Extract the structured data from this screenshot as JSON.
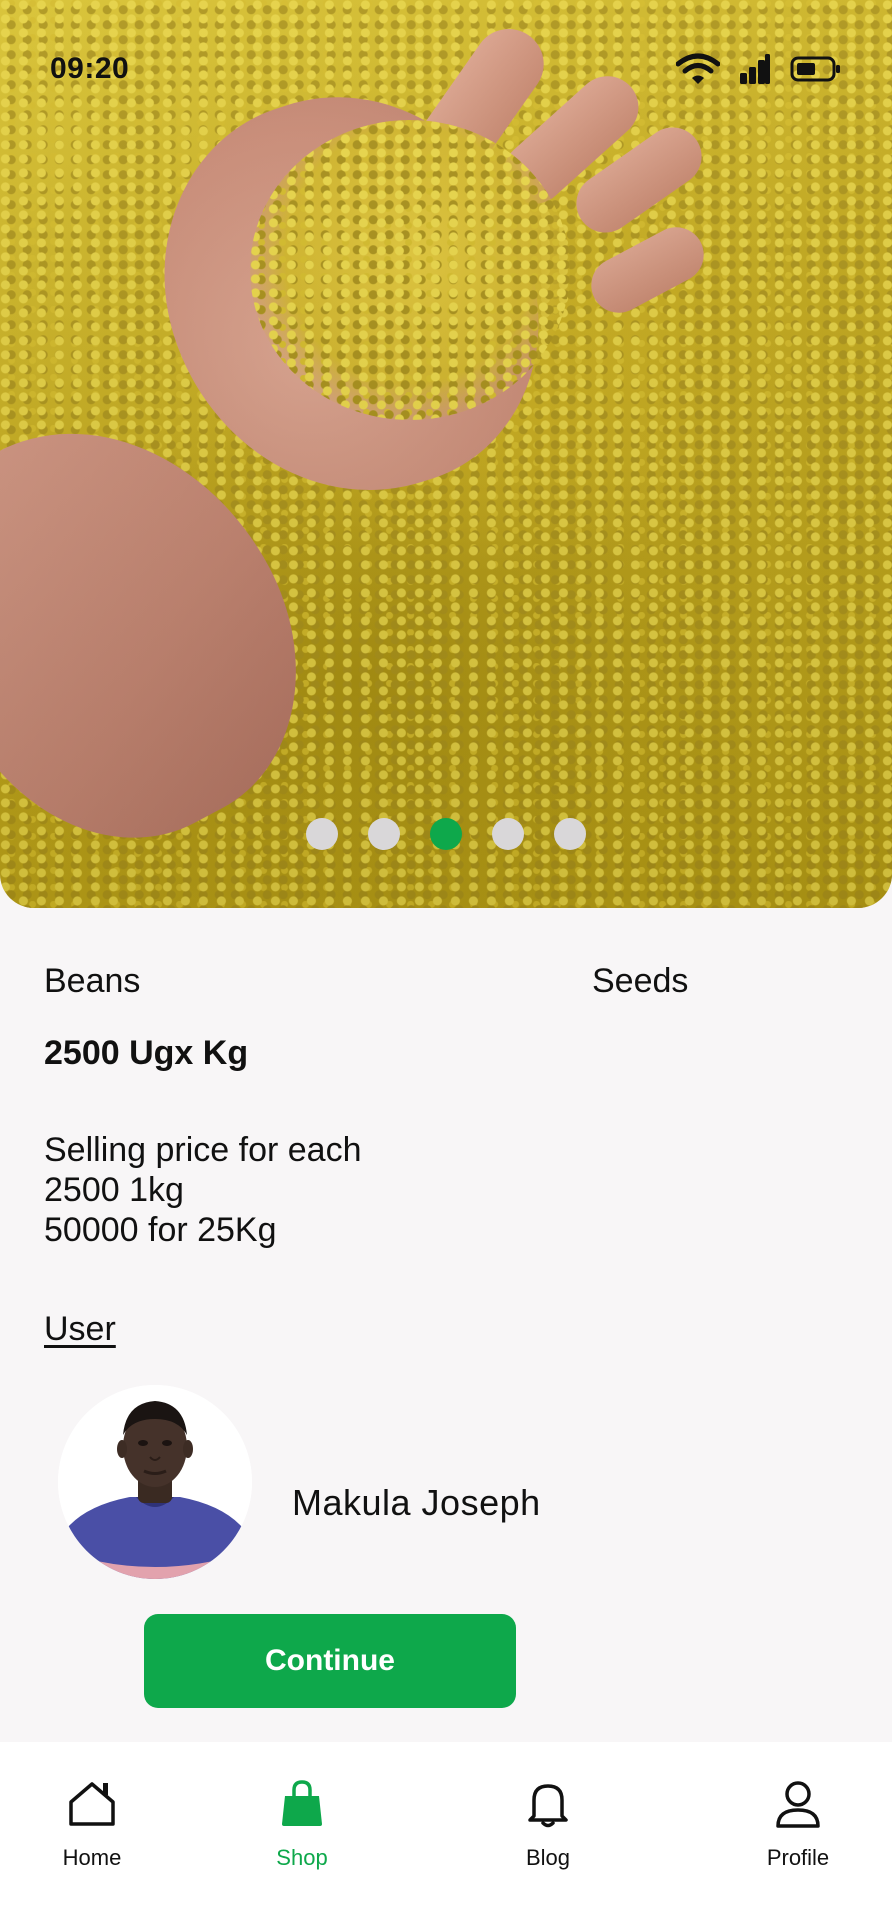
{
  "status_bar": {
    "time": "09:20",
    "icons": [
      "wifi-icon",
      "signal-icon",
      "battery-icon"
    ]
  },
  "hero": {
    "image": "beans-in-hand-photo",
    "carousel": {
      "count": 5,
      "active_index": 2
    }
  },
  "product": {
    "name": "Beans",
    "category": "Seeds",
    "price": "2500 Ugx Kg",
    "description_lines": [
      "Selling price for each",
      "2500 1kg",
      "50000 for 25Kg"
    ]
  },
  "user": {
    "heading": "User",
    "name": "Makula Joseph"
  },
  "actions": {
    "continue_label": "Continue"
  },
  "nav": {
    "items": [
      {
        "label": "Home",
        "icon": "home-icon",
        "active": false
      },
      {
        "label": "Shop",
        "icon": "shopping-bag-icon",
        "active": true
      },
      {
        "label": "Blog",
        "icon": "bell-icon",
        "active": false
      },
      {
        "label": "Profile",
        "icon": "user-icon",
        "active": false
      }
    ]
  },
  "colors": {
    "accent": "#0ea84b",
    "background": "#f8f6f7",
    "inactive_dot": "#d9d7d9",
    "nav_background": "#ffffff"
  }
}
